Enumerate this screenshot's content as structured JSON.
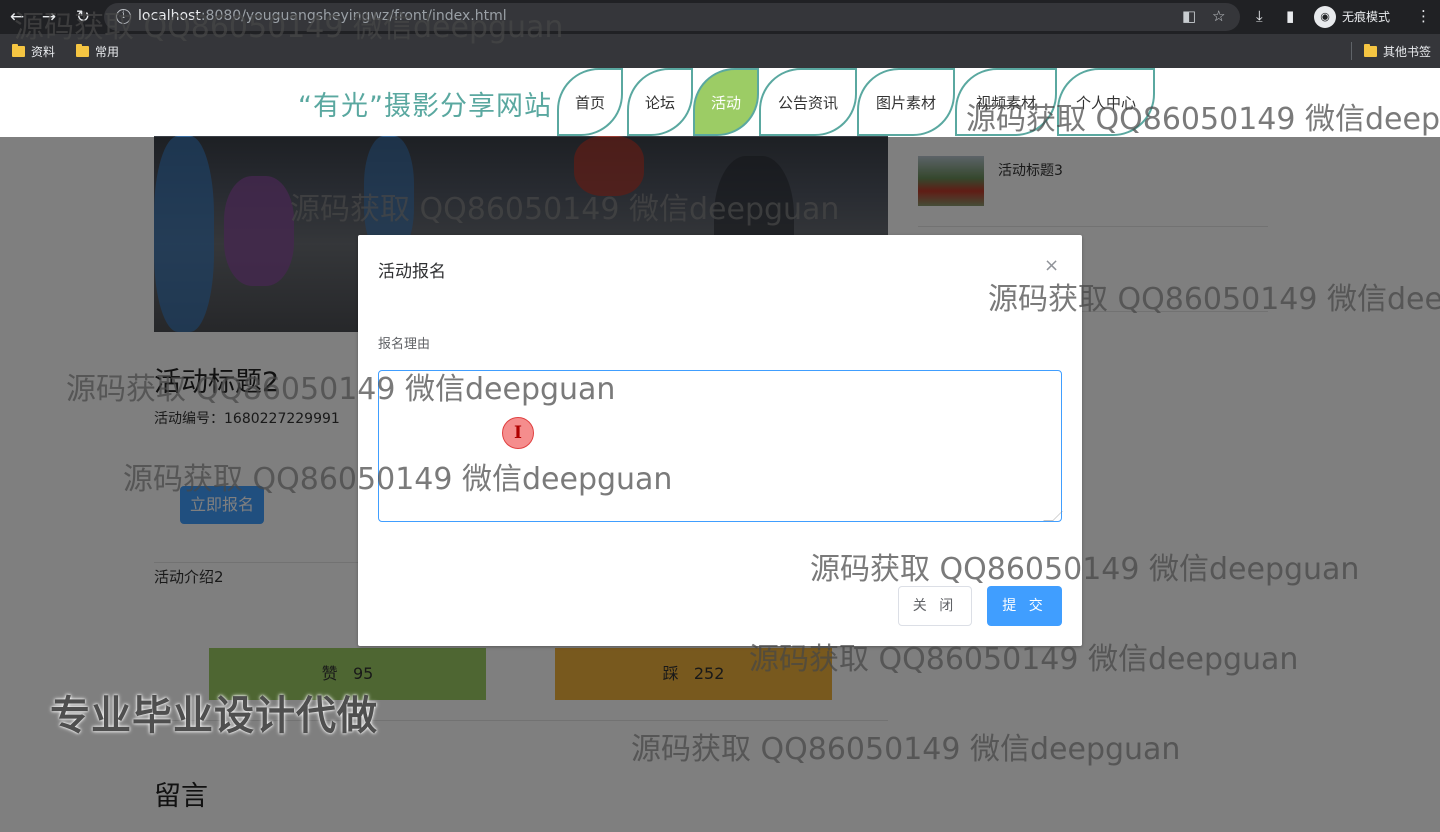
{
  "browser": {
    "url_host": "localhost",
    "url_rest": ":8080/youguangsheyingwz/front/index.html",
    "profile_label": "无痕模式",
    "bookmarks": [
      "资料",
      "常用"
    ],
    "other_bookmarks": "其他书签"
  },
  "site": {
    "title": "“有光”摄影分享网站",
    "nav": [
      "首页",
      "论坛",
      "活动",
      "公告资讯",
      "图片素材",
      "视频素材",
      "个人中心"
    ],
    "active_nav": "活动"
  },
  "sidebar": {
    "item_title": "活动标题3"
  },
  "activity": {
    "title": "活动标题2",
    "number_label": "活动编号：",
    "number_value": "1680227229991",
    "signup_button": "立即报名",
    "intro": "活动介绍2",
    "like_label": "赞",
    "like_count": "95",
    "dislike_label": "踩",
    "dislike_count": "252",
    "message_heading": "留言"
  },
  "dialog": {
    "title": "活动报名",
    "field_label": "报名理由",
    "reason_value": "",
    "close_button": "关 闭",
    "submit_button": "提 交"
  },
  "watermarks": {
    "text": "源码获取 QQ86050149 微信deepguan",
    "promo": "专业毕业设计代做"
  },
  "colors": {
    "primary": "#409eff",
    "nav_accent": "#5aa8a0",
    "active_nav": "#9ccc65",
    "like": "#9ccc65",
    "dislike": "#f1b23c"
  }
}
